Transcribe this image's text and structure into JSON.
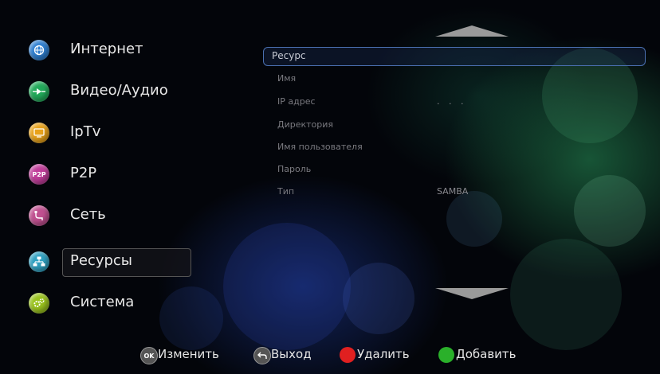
{
  "sidebar": {
    "items": [
      {
        "label": "Интернет",
        "icon": "globe-icon",
        "color": "#2f7fd0"
      },
      {
        "label": "Видео/Аудио",
        "icon": "play-icon",
        "color": "#22aa5a"
      },
      {
        "label": "IpTv",
        "icon": "tv-icon",
        "color": "#e8a21a"
      },
      {
        "label": "P2P",
        "icon": "p2p-icon",
        "color": "#c03d9a",
        "icon_text": "P2P"
      },
      {
        "label": "Сеть",
        "icon": "network-plug-icon",
        "color": "#c05090"
      },
      {
        "label": "Ресурсы",
        "icon": "resources-icon",
        "color": "#2fa0c0"
      },
      {
        "label": "Система",
        "icon": "gears-icon",
        "color": "#9ac31e"
      }
    ],
    "selected": "Ресурсы"
  },
  "form": {
    "fields": [
      {
        "label": "Ресурс",
        "value": ""
      },
      {
        "label": "Имя",
        "value": ""
      },
      {
        "label": "IP адрес",
        "value": ". . ."
      },
      {
        "label": "Директория",
        "value": ""
      },
      {
        "label": "Имя пользователя",
        "value": ""
      },
      {
        "label": "Пароль",
        "value": ""
      },
      {
        "label": "Тип",
        "value": "SAMBA"
      }
    ],
    "active_field": "Ресурс"
  },
  "hints": [
    {
      "label": "Изменить",
      "icon": "ok-button-icon",
      "icon_text": "OK",
      "color": "#555555"
    },
    {
      "label": "Выход",
      "icon": "back-button-icon",
      "color": "#555555"
    },
    {
      "label": "Удалить",
      "icon": "red-button-icon",
      "color": "#e02020"
    },
    {
      "label": "Добавить",
      "icon": "green-button-icon",
      "color": "#2ab02a"
    }
  ],
  "colors": {
    "background": "#03050a",
    "selection_border": "#4a6fb0",
    "arrow": "#9a9a9a"
  }
}
